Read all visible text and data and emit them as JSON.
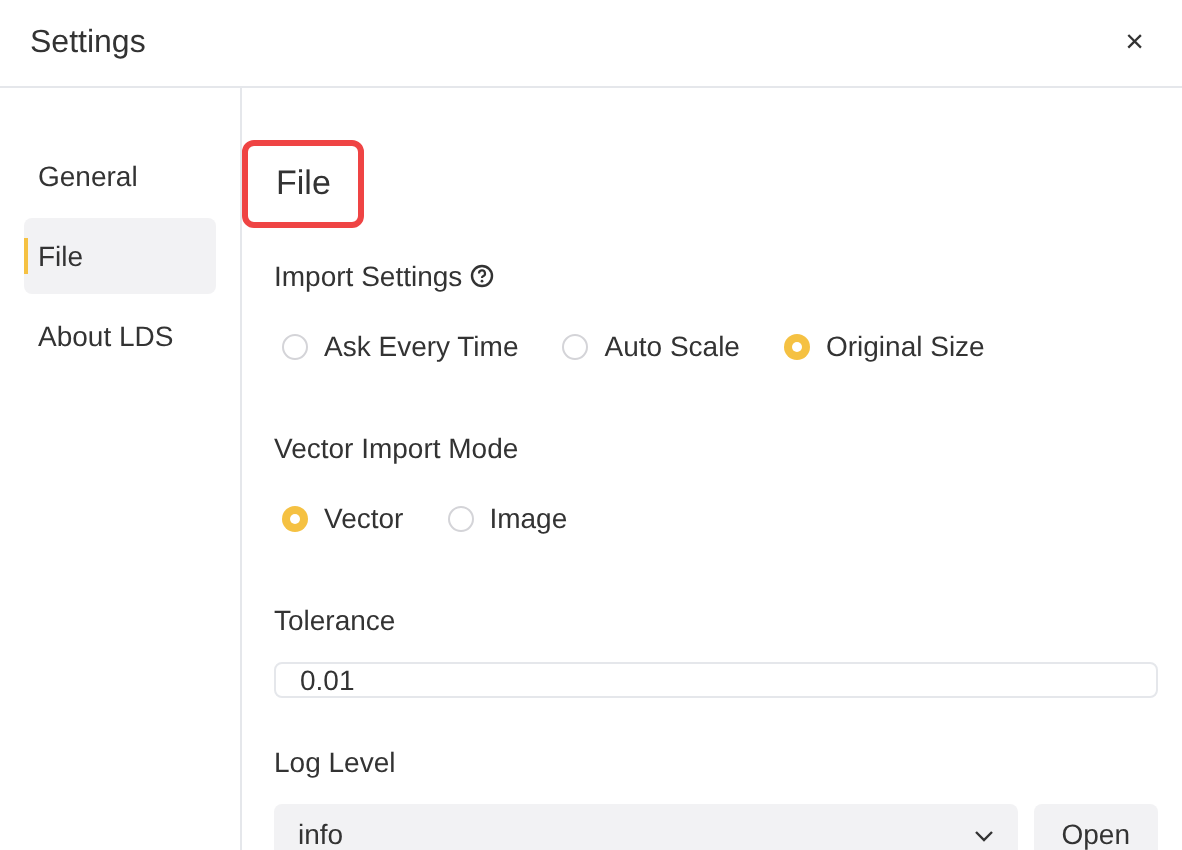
{
  "window": {
    "title": "Settings",
    "close": "×"
  },
  "sidebar": {
    "items": [
      {
        "label": "General",
        "selected": false
      },
      {
        "label": "File",
        "selected": true
      },
      {
        "label": "About LDS",
        "selected": false
      }
    ]
  },
  "content": {
    "heading": "File",
    "heading_highlighted": true,
    "import_settings": {
      "label": "Import Settings",
      "options": [
        {
          "label": "Ask Every Time",
          "selected": false
        },
        {
          "label": "Auto Scale",
          "selected": false
        },
        {
          "label": "Original Size",
          "selected": true
        }
      ]
    },
    "vector_import_mode": {
      "label": "Vector Import Mode",
      "options": [
        {
          "label": "Vector",
          "selected": true
        },
        {
          "label": "Image",
          "selected": false
        }
      ]
    },
    "tolerance": {
      "label": "Tolerance",
      "value": "0.01"
    },
    "log_level": {
      "label": "Log Level",
      "value": "info",
      "button": "Open"
    }
  }
}
